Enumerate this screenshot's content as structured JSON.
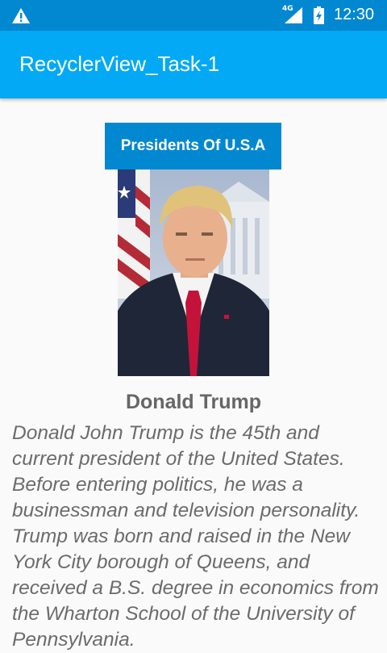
{
  "status_bar": {
    "network": "4G",
    "time": "12:30"
  },
  "app_bar": {
    "title": "RecyclerView_Task-1"
  },
  "list": {
    "header": "Presidents Of U.S.A",
    "items": [
      {
        "name": "Donald Trump",
        "description": "Donald John Trump is the 45th and current president of the United States. Before entering politics, he was a businessman and television personality. Trump was born and raised in the New York City borough of Queens, and received a B.S. degree in economics from the Wharton School of the University of Pennsylvania."
      }
    ]
  },
  "colors": {
    "status_bar": "#0288d1",
    "app_bar": "#03a9f4",
    "header_label": "#0288d1",
    "text_gray": "#666666"
  }
}
